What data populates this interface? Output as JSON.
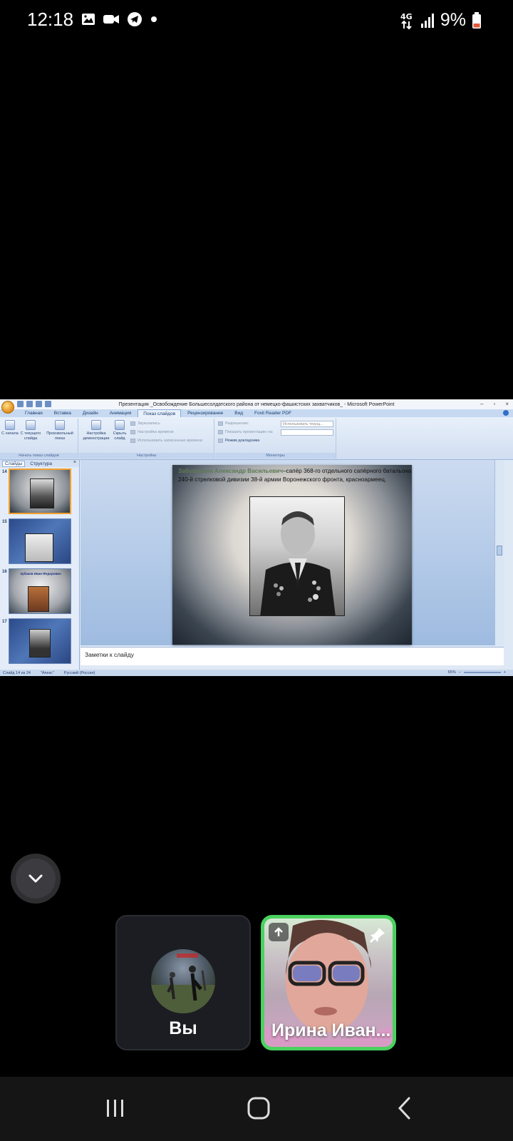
{
  "status_bar": {
    "time": "12:18",
    "network": "4G",
    "battery": "9%",
    "battery_color": "#e05a3a"
  },
  "presentation": {
    "window_title": "Презентация _Освобождение Большесолдатского района от немецко-фашистских захватчиков_ - Microsoft PowerPoint",
    "tabs": [
      "Главная",
      "Вставка",
      "Дизайн",
      "Анимация",
      "Показ слайдов",
      "Рецензирование",
      "Вид",
      "Foxit Reader PDF"
    ],
    "active_tab": "Показ слайдов",
    "ribbon": {
      "start_group_label": "Начать показ слайдов",
      "from_start": "С начала",
      "from_current": "С текущего слайда",
      "custom_show": "Произвольный показ",
      "setup_group_label": "Настройка",
      "setup_show": "Настройка демонстрации",
      "hide_slide": "Скрыть слайд",
      "record": "Звукозапись",
      "rehearse": "Настройка времени",
      "use_timings": "Использовать записанные времена",
      "monitors_group_label": "Мониторы",
      "resolution": "Разрешение:",
      "resolution_value": "Использовать текущ...",
      "show_on": "Показать презентацию на:",
      "presenter_view": "Режим докладчика"
    },
    "pane_tabs": [
      "Слайды",
      "Структура"
    ],
    "thumbnails": [
      {
        "number": "14",
        "caption": ""
      },
      {
        "number": "15",
        "caption": ""
      },
      {
        "number": "16",
        "caption": "Зубаков Иван Федорович"
      },
      {
        "number": "17",
        "caption": ""
      }
    ],
    "slide": {
      "name": "Забоврокин Александр Васильевич",
      "text": "–сапёр 368-го отдельного сапёрного батальона 240-й стрелковой дивизии 38-й армии Воронежского фронта, красноармеец."
    },
    "notes_placeholder": "Заметки к слайду",
    "status": {
      "slide_counter": "Слайд 14 из 24",
      "theme": "\"Апекс\"",
      "language": "Русский (Россия)",
      "zoom": "65%"
    }
  },
  "call": {
    "self_label": "Вы",
    "participant_name": "Ирина Иван...",
    "participant_border": "#4bd15f"
  },
  "icons": {
    "collapse": "chevron-down-icon",
    "pin": "pin-icon",
    "upload": "arrow-up-icon",
    "nav_recent": "recent-apps-icon",
    "nav_home": "home-icon",
    "nav_back": "back-icon"
  }
}
